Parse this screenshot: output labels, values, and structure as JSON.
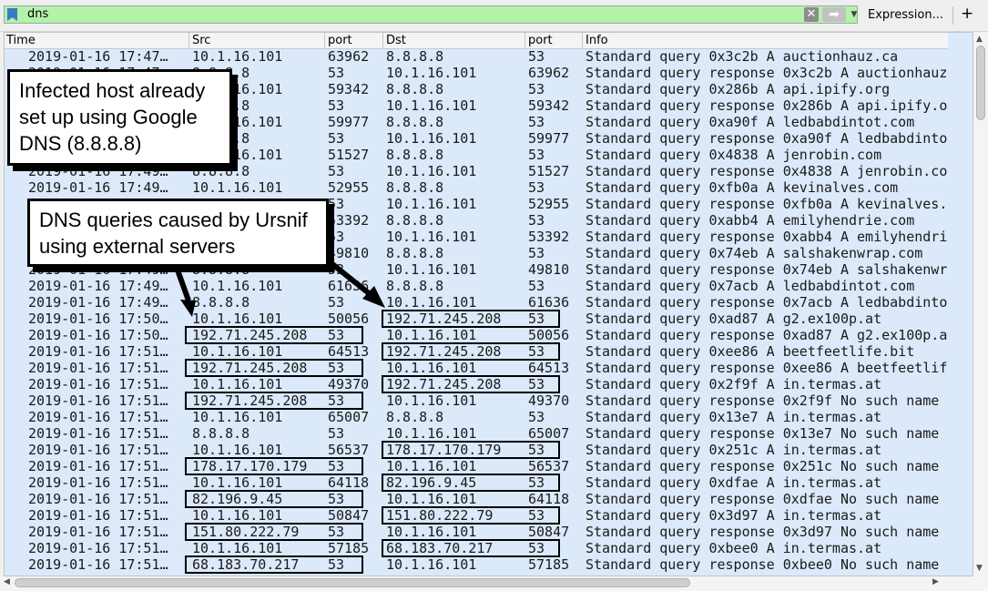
{
  "filter": {
    "value": "dns",
    "expression_label": "Expression...",
    "add_label": "+"
  },
  "columns": [
    "Time",
    "Src",
    "port",
    "Dst",
    "port",
    "Info"
  ],
  "rows": [
    [
      "2019-01-16 17:47…",
      "10.1.16.101",
      "63962",
      "8.8.8.8",
      "53",
      "Standard query 0x3c2b A auctionhauz.ca"
    ],
    [
      "2019-01-16 17:47…",
      "8.8.8.8",
      "53",
      "10.1.16.101",
      "63962",
      "Standard query response 0x3c2b A auctionhauz.ca"
    ],
    [
      "2019-01-16 17:48…",
      "10.1.16.101",
      "59342",
      "8.8.8.8",
      "53",
      "Standard query 0x286b A api.ipify.org"
    ],
    [
      "2019-01-16 17:48…",
      "8.8.8.8",
      "53",
      "10.1.16.101",
      "59342",
      "Standard query response 0x286b A api.ipify.org"
    ],
    [
      "2019-01-16 17:48…",
      "10.1.16.101",
      "59977",
      "8.8.8.8",
      "53",
      "Standard query 0xa90f A ledbabdintot.com"
    ],
    [
      "2019-01-16 17:48…",
      "8.8.8.8",
      "53",
      "10.1.16.101",
      "59977",
      "Standard query response 0xa90f A ledbabdintot.com"
    ],
    [
      "2019-01-16 17:49…",
      "10.1.16.101",
      "51527",
      "8.8.8.8",
      "53",
      "Standard query 0x4838 A jenrobin.com"
    ],
    [
      "2019-01-16 17:49…",
      "8.8.8.8",
      "53",
      "10.1.16.101",
      "51527",
      "Standard query response 0x4838 A jenrobin.com"
    ],
    [
      "2019-01-16 17:49…",
      "10.1.16.101",
      "52955",
      "8.8.8.8",
      "53",
      "Standard query 0xfb0a A kevinalves.com"
    ],
    [
      "2019-01-16 17:49…",
      "8.8.8.8",
      "53",
      "10.1.16.101",
      "52955",
      "Standard query response 0xfb0a A kevinalves.com"
    ],
    [
      "2019-01-16 17:49…",
      "10.1.16.101",
      "53392",
      "8.8.8.8",
      "53",
      "Standard query 0xabb4 A emilyhendrie.com"
    ],
    [
      "2019-01-16 17:49…",
      "8.8.8.8",
      "53",
      "10.1.16.101",
      "53392",
      "Standard query response 0xabb4 A emilyhendrie.com"
    ],
    [
      "2019-01-16 17:49…",
      "10.1.16.101",
      "49810",
      "8.8.8.8",
      "53",
      "Standard query 0x74eb A salshakenwrap.com"
    ],
    [
      "2019-01-16 17:49…",
      "8.8.8.8",
      "53",
      "10.1.16.101",
      "49810",
      "Standard query response 0x74eb A salshakenwrap.com"
    ],
    [
      "2019-01-16 17:49…",
      "10.1.16.101",
      "61636",
      "8.8.8.8",
      "53",
      "Standard query 0x7acb A ledbabdintot.com"
    ],
    [
      "2019-01-16 17:49…",
      "8.8.8.8",
      "53",
      "10.1.16.101",
      "61636",
      "Standard query response 0x7acb A ledbabdintot.com"
    ],
    [
      "2019-01-16 17:50…",
      "10.1.16.101",
      "50056",
      "192.71.245.208",
      "53",
      "Standard query 0xad87 A g2.ex100p.at"
    ],
    [
      "2019-01-16 17:50…",
      "192.71.245.208",
      "53",
      "10.1.16.101",
      "50056",
      "Standard query response 0xad87 A g2.ex100p.at"
    ],
    [
      "2019-01-16 17:51…",
      "10.1.16.101",
      "64513",
      "192.71.245.208",
      "53",
      "Standard query 0xee86 A beetfeetlife.bit"
    ],
    [
      "2019-01-16 17:51…",
      "192.71.245.208",
      "53",
      "10.1.16.101",
      "64513",
      "Standard query response 0xee86 A beetfeetlife.bit"
    ],
    [
      "2019-01-16 17:51…",
      "10.1.16.101",
      "49370",
      "192.71.245.208",
      "53",
      "Standard query 0x2f9f A in.termas.at"
    ],
    [
      "2019-01-16 17:51…",
      "192.71.245.208",
      "53",
      "10.1.16.101",
      "49370",
      "Standard query response 0x2f9f No such name"
    ],
    [
      "2019-01-16 17:51…",
      "10.1.16.101",
      "65007",
      "8.8.8.8",
      "53",
      "Standard query 0x13e7 A in.termas.at"
    ],
    [
      "2019-01-16 17:51…",
      "8.8.8.8",
      "53",
      "10.1.16.101",
      "65007",
      "Standard query response 0x13e7 No such name"
    ],
    [
      "2019-01-16 17:51…",
      "10.1.16.101",
      "56537",
      "178.17.170.179",
      "53",
      "Standard query 0x251c A in.termas.at"
    ],
    [
      "2019-01-16 17:51…",
      "178.17.170.179",
      "53",
      "10.1.16.101",
      "56537",
      "Standard query response 0x251c No such name"
    ],
    [
      "2019-01-16 17:51…",
      "10.1.16.101",
      "64118",
      "82.196.9.45",
      "53",
      "Standard query 0xdfae A in.termas.at"
    ],
    [
      "2019-01-16 17:51…",
      "82.196.9.45",
      "53",
      "10.1.16.101",
      "64118",
      "Standard query response 0xdfae No such name"
    ],
    [
      "2019-01-16 17:51…",
      "10.1.16.101",
      "50847",
      "151.80.222.79",
      "53",
      "Standard query 0x3d97 A in.termas.at"
    ],
    [
      "2019-01-16 17:51…",
      "151.80.222.79",
      "53",
      "10.1.16.101",
      "50847",
      "Standard query response 0x3d97 No such name"
    ],
    [
      "2019-01-16 17:51…",
      "10.1.16.101",
      "57185",
      "68.183.70.217",
      "53",
      "Standard query 0xbee0 A in.termas.at"
    ],
    [
      "2019-01-16 17:51…",
      "68.183.70.217",
      "53",
      "10.1.16.101",
      "57185",
      "Standard query response 0xbee0 No such name"
    ]
  ],
  "annotations": {
    "callout_1": "Infected host already set up using Google DNS (8.8.8.8)",
    "callout_2": "DNS queries caused by Ursnif using external servers"
  },
  "colors": {
    "filter_ok": "#b3f2a8",
    "row_bg": "#dbe9fb",
    "highlight_border": "#000000"
  }
}
